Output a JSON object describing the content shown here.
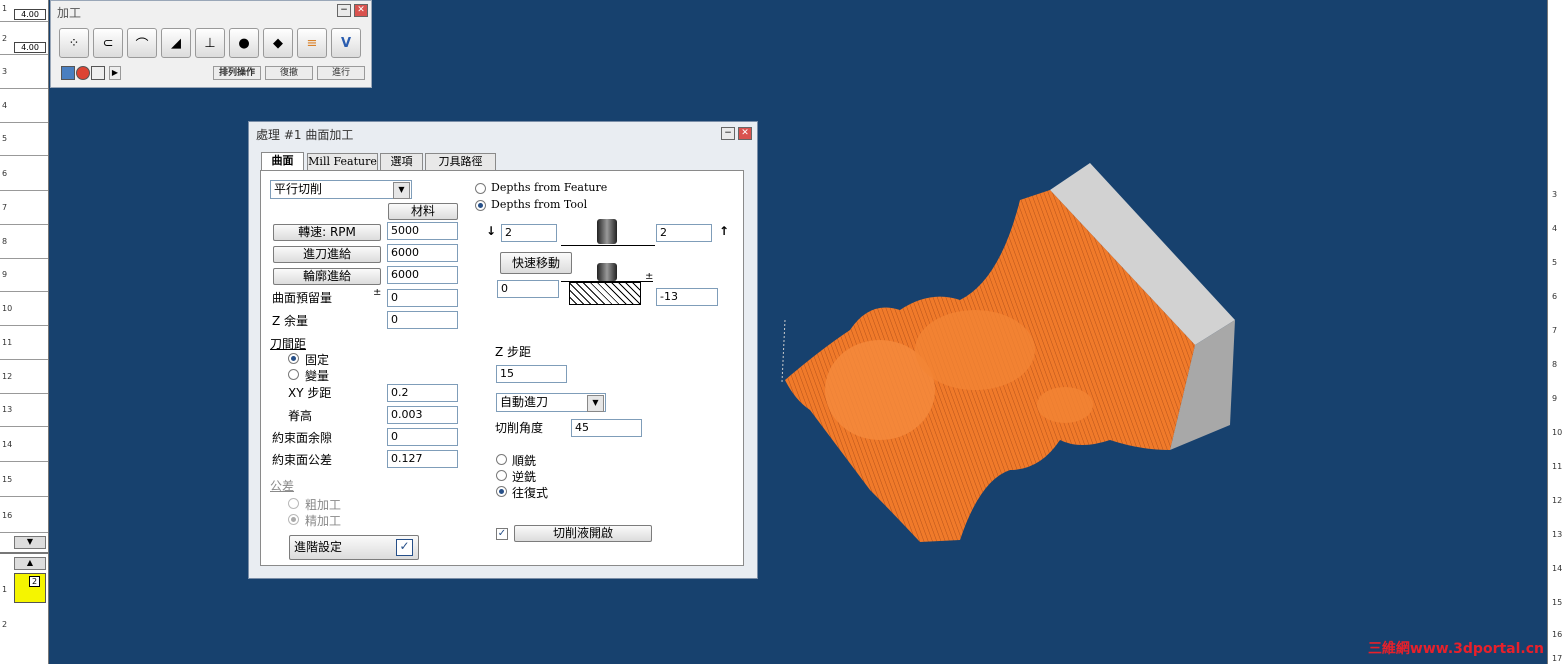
{
  "left_strip": {
    "rows": [
      "1",
      "2",
      "3",
      "4",
      "5",
      "6",
      "7",
      "8",
      "9",
      "10",
      "11",
      "12",
      "13",
      "14",
      "15",
      "16"
    ],
    "tool_values": [
      "4.00",
      "4.00"
    ],
    "lower_rows": [
      "1",
      "2"
    ],
    "selected_tool_number": "2"
  },
  "right_strip": {
    "rows": [
      "3",
      "4",
      "5",
      "6",
      "7",
      "8",
      "9",
      "10",
      "11",
      "12",
      "13",
      "14",
      "15",
      "16",
      "17"
    ]
  },
  "toolbar": {
    "title": "加工",
    "buttons": [
      "point-drill-icon",
      "contour-icon",
      "pocket-icon",
      "surface-icon",
      "profile-icon",
      "rough-icon",
      "finish-icon",
      "pencil-icon",
      "verify-icon"
    ],
    "sort_label": "排列操作",
    "undo_label": "復撤",
    "run_label": "進行"
  },
  "dialog": {
    "title": "處理 #1 曲面加工",
    "tabs": [
      "曲面",
      "Mill Feature",
      "選項",
      "刀具路徑"
    ],
    "strategy": "平行切削",
    "material_label": "材料",
    "speed_label": "轉速: RPM",
    "speed_value": "5000",
    "feed_label": "進刀進給",
    "feed_value": "6000",
    "contour_feed_label": "輪廓進給",
    "contour_feed_value": "6000",
    "surface_stock_label": "曲面預留量",
    "surface_stock_value": "0",
    "z_stock_label": "Z 余量",
    "z_stock_value": "0",
    "stepover_label": "刀間距",
    "fixed_label": "固定",
    "variable_label": "變量",
    "xy_step_label": "XY 步距",
    "xy_step_value": "0.2",
    "cusp_label": "脊高",
    "cusp_value": "0.003",
    "constraint_clearance_label": "約束面余隙",
    "constraint_clearance_value": "0",
    "constraint_tolerance_label": "約束面公差",
    "constraint_tolerance_value": "0.127",
    "tolerance_label": "公差",
    "rough_label": "粗加工",
    "finish_label": "精加工",
    "advanced_label": "進階設定",
    "depth_feature_label": "Depths from Feature",
    "depth_tool_label": "Depths from Tool",
    "top_left_value": "2",
    "top_right_value": "2",
    "rapid_label": "快速移動",
    "bottom_left_value": "0",
    "bottom_right_value": "-13",
    "z_step_label": "Z 步距",
    "z_step_value": "15",
    "entry_mode": "自動進刀",
    "cut_angle_label": "切削角度",
    "cut_angle_value": "45",
    "climb_label": "順銑",
    "conventional_label": "逆銑",
    "zigzag_label": "往復式",
    "coolant_label": "切削液開啟",
    "colors": {
      "accent": "#264f88",
      "part_orange": "#f07a2a",
      "stock_gray": "#a8a8a8",
      "background": "#17416e"
    }
  },
  "watermark": "三維網www.3dportal.cn"
}
